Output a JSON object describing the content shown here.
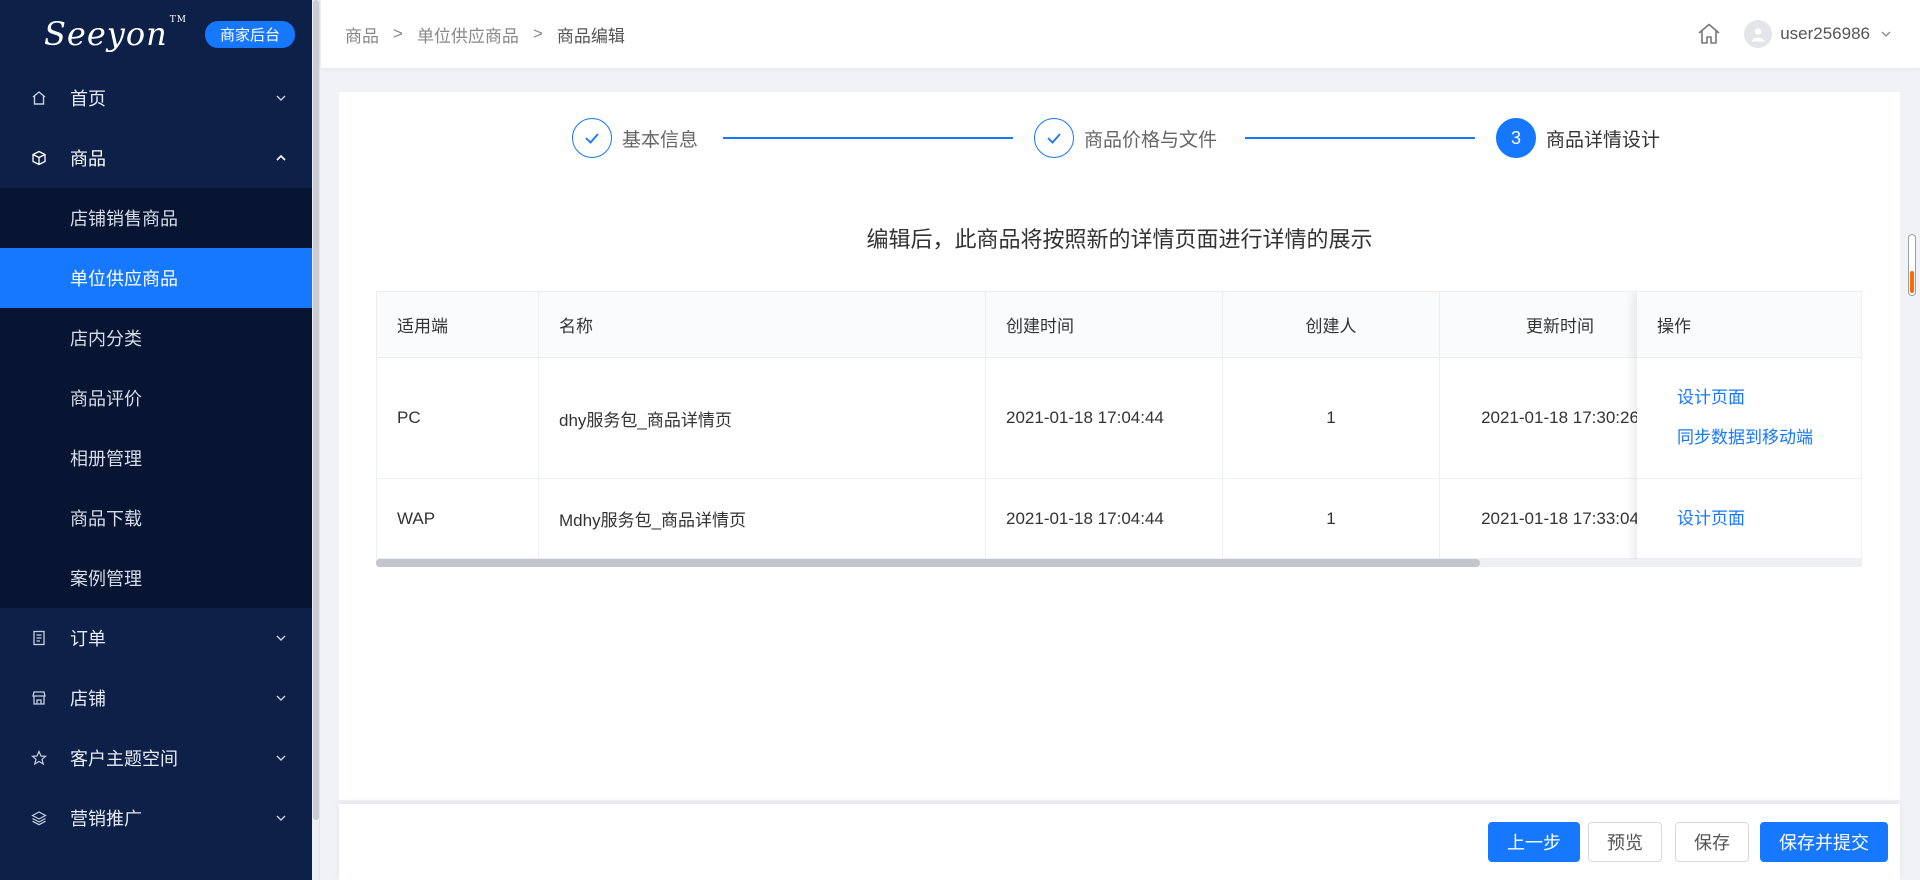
{
  "brand": {
    "logo": "Seeyon",
    "tm": "TM",
    "badge": "商家后台"
  },
  "sidebar": {
    "groups": [
      {
        "label": "首页",
        "icon": "home-icon",
        "expanded": false
      },
      {
        "label": "商品",
        "icon": "cube-icon",
        "expanded": true,
        "items": [
          "店铺销售商品",
          "单位供应商品",
          "店内分类",
          "商品评价",
          "相册管理",
          "商品下载",
          "案例管理"
        ],
        "active_item": "单位供应商品"
      },
      {
        "label": "订单",
        "icon": "document-icon",
        "expanded": false
      },
      {
        "label": "店铺",
        "icon": "store-icon",
        "expanded": false
      },
      {
        "label": "客户主题空间",
        "icon": "star-icon",
        "expanded": false
      },
      {
        "label": "营销推广",
        "icon": "layers-icon",
        "expanded": false
      }
    ]
  },
  "header": {
    "breadcrumb": [
      "商品",
      "单位供应商品",
      "商品编辑"
    ],
    "separator": ">",
    "username": "user256986"
  },
  "steps": [
    {
      "label": "基本信息",
      "status": "done"
    },
    {
      "label": "商品价格与文件",
      "status": "done"
    },
    {
      "label": "商品详情设计",
      "status": "current",
      "number": "3"
    }
  ],
  "notice": "编辑后，此商品将按照新的详情页面进行详情的展示",
  "table": {
    "columns": [
      "适用端",
      "名称",
      "创建时间",
      "创建人",
      "更新时间",
      "操作"
    ],
    "rows": [
      {
        "platform": "PC",
        "name": "dhy服务包_商品详情页",
        "created": "2021-01-18 17:04:44",
        "creator": "1",
        "updated": "2021-01-18 17:30:26",
        "actions": [
          "设计页面",
          "同步数据到移动端"
        ]
      },
      {
        "platform": "WAP",
        "name": "Mdhy服务包_商品详情页",
        "created": "2021-01-18 17:04:44",
        "creator": "1",
        "updated": "2021-01-18 17:33:04",
        "actions": [
          "设计页面"
        ]
      }
    ]
  },
  "footer": {
    "prev": "上一步",
    "preview": "预览",
    "save": "保存",
    "save_submit": "保存并提交"
  },
  "colors": {
    "primary": "#1677ff",
    "sidebar_bg": "#0d2048",
    "submenu_bg": "#071533"
  }
}
